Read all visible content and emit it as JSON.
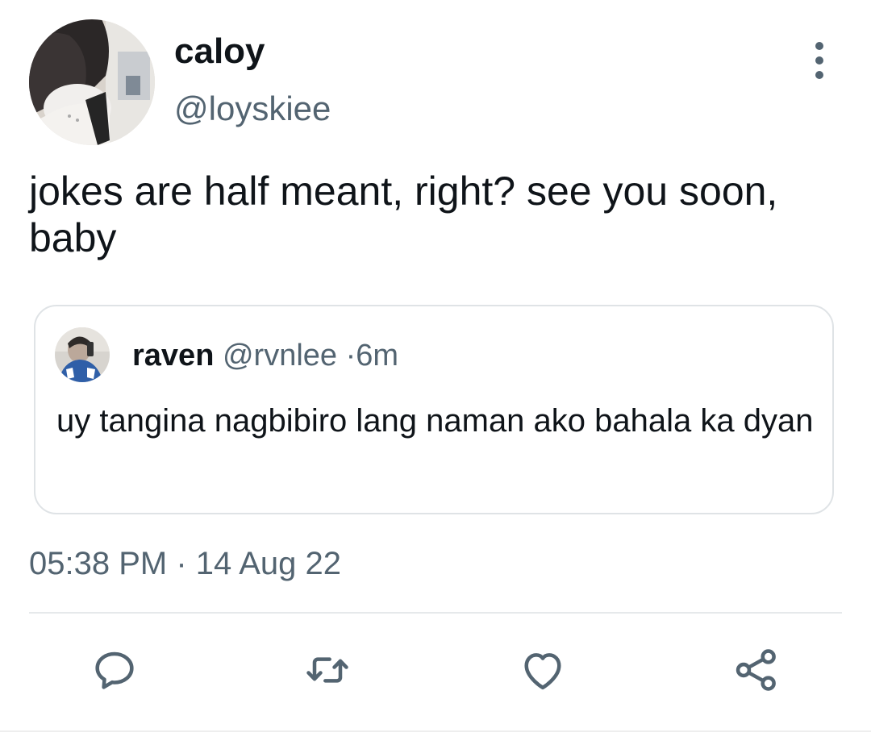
{
  "author": {
    "display_name": "caloy",
    "handle": "@loyskiee"
  },
  "tweet": {
    "text": "jokes are half meant, right? see you soon, baby",
    "time": "05:38 PM",
    "separator": "·",
    "date": "14 Aug 22"
  },
  "quoted_tweet": {
    "display_name": "raven",
    "handle": "@rvnlee",
    "separator": "·",
    "age": "6m",
    "text": "uy tangina nagbibiro lang naman ako bahala ka dyan"
  },
  "icons": {
    "more": "more-vertical-icon",
    "reply": "reply-icon",
    "retweet": "retweet-icon",
    "like": "heart-icon",
    "share": "share-icon"
  },
  "colors": {
    "primary_text": "#0f1419",
    "secondary_text": "#536471",
    "border": "#dfe3e6",
    "icon": "#536471"
  }
}
